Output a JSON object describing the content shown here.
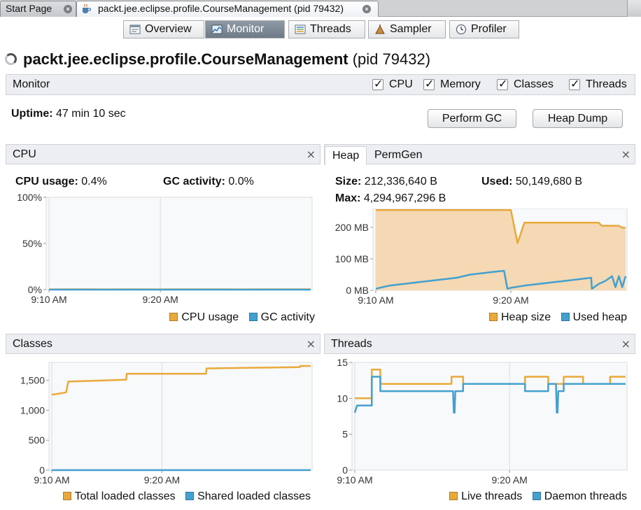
{
  "editor_tabs": [
    {
      "label": "Start Page",
      "active": false
    },
    {
      "label": "packt.jee.eclipse.profile.CourseManagement (pid 79432)",
      "active": true
    }
  ],
  "view_tabs": [
    {
      "label": "Overview",
      "icon": "overview-icon",
      "selected": false
    },
    {
      "label": "Monitor",
      "icon": "monitor-chart-icon",
      "selected": true
    },
    {
      "label": "Threads",
      "icon": "threads-list-icon",
      "selected": false
    },
    {
      "label": "Sampler",
      "icon": "sampler-icon",
      "selected": false
    },
    {
      "label": "Profiler",
      "icon": "profiler-clock-icon",
      "selected": false
    }
  ],
  "header": {
    "title": "packt.jee.eclipse.profile.CourseManagement",
    "pid": "(pid 79432)"
  },
  "monitor_bar": {
    "label": "Monitor",
    "checkboxes": [
      {
        "label": "CPU",
        "checked": true
      },
      {
        "label": "Memory",
        "checked": true
      },
      {
        "label": "Classes",
        "checked": true
      },
      {
        "label": "Threads",
        "checked": true
      }
    ]
  },
  "uptime": {
    "label": "Uptime:",
    "value": "47 min 10 sec"
  },
  "buttons": {
    "perform_gc": "Perform GC",
    "heap_dump": "Heap Dump"
  },
  "colors": {
    "orange": "#e9a93a",
    "blue": "#43a0cf",
    "heap_fill": "#f4d9b4",
    "grid": "#d9dcdf"
  },
  "cpu_panel": {
    "title": "CPU",
    "close": "×",
    "stats": [
      {
        "label": "CPU usage:",
        "value": "0.4%"
      },
      {
        "label": "GC activity:",
        "value": "0.0%"
      }
    ],
    "y_ticks": [
      "100%",
      "50%",
      "0%"
    ],
    "x_ticks": [
      "9:10 AM",
      "9:20 AM"
    ],
    "legend": [
      "CPU usage",
      "GC activity"
    ]
  },
  "heap_panel": {
    "tabs": [
      "Heap",
      "PermGen"
    ],
    "close": "×",
    "size": {
      "label": "Size:",
      "value": "212,336,640 B"
    },
    "used": {
      "label": "Used:",
      "value": "50,149,680 B"
    },
    "max": {
      "label": "Max:",
      "value": "4,294,967,296 B"
    },
    "y_ticks": [
      "200 MB",
      "100 MB",
      "0 MB"
    ],
    "x_ticks": [
      "9:10 AM",
      "9:20 AM"
    ],
    "legend": [
      "Heap size",
      "Used heap"
    ]
  },
  "classes_panel": {
    "title": "Classes",
    "close": "×",
    "y_ticks": [
      "1,500",
      "1,000",
      "500",
      "0"
    ],
    "x_ticks": [
      "9:10 AM",
      "9:20 AM"
    ],
    "legend": [
      "Total loaded classes",
      "Shared loaded classes"
    ]
  },
  "threads_panel": {
    "title": "Threads",
    "close": "×",
    "y_ticks": [
      "15",
      "10",
      "5",
      "0"
    ],
    "x_ticks": [
      "9:10 AM",
      "9:20 AM"
    ],
    "legend": [
      "Live threads",
      "Daemon threads"
    ]
  },
  "chart_data": [
    {
      "type": "line",
      "panel": "CPU",
      "series": [
        {
          "name": "CPU usage",
          "x_min": [
            0,
            5,
            10,
            15,
            20,
            25,
            30,
            35,
            40,
            45,
            47
          ],
          "values": [
            0.3,
            0.4,
            0.3,
            0.4,
            0.3,
            0.4,
            0.4,
            0.3,
            0.4,
            0.4,
            0.4
          ]
        },
        {
          "name": "GC activity",
          "x_min": [
            0,
            47
          ],
          "values": [
            0,
            0
          ]
        }
      ],
      "xlabel": "",
      "ylabel": "",
      "ylim": [
        0,
        100
      ],
      "x_ticks": [
        "9:10 AM",
        "9:20 AM"
      ],
      "legend_position": "bottom-right"
    },
    {
      "type": "area",
      "panel": "Heap",
      "series": [
        {
          "name": "Heap size",
          "unit": "MB",
          "x_min": [
            0,
            0.5,
            20,
            21,
            22,
            33,
            33.5,
            36,
            36.5,
            37
          ],
          "values": [
            255,
            255,
            255,
            150,
            215,
            215,
            205,
            205,
            199,
            199
          ]
        },
        {
          "name": "Used heap",
          "unit": "MB",
          "x_min": [
            0,
            1,
            2,
            4,
            6,
            8,
            10,
            12,
            14,
            16,
            18,
            19,
            19.5,
            20,
            22,
            24,
            26,
            28,
            30,
            31.9,
            32,
            33,
            34,
            35,
            35.5,
            36,
            36.5,
            37
          ],
          "values": [
            5,
            10,
            15,
            20,
            25,
            30,
            35,
            40,
            50,
            55,
            60,
            62,
            5,
            8,
            15,
            20,
            25,
            30,
            35,
            40,
            5,
            20,
            30,
            45,
            10,
            45,
            10,
            45
          ]
        }
      ],
      "xlabel": "",
      "ylabel": "",
      "ylim": [
        0,
        260
      ],
      "y_ticks": [
        0,
        100,
        200
      ],
      "x_ticks": [
        "9:10 AM",
        "9:20 AM"
      ],
      "legend_position": "bottom-right"
    },
    {
      "type": "line",
      "panel": "Classes",
      "series": [
        {
          "name": "Total loaded classes",
          "x_min": [
            0,
            1.4,
            1.5,
            2.6,
            3.0,
            13.5,
            13.6,
            28.0,
            28.1,
            45.0,
            45.1,
            47
          ],
          "values": [
            1260,
            1280,
            1280,
            1300,
            1480,
            1510,
            1610,
            1610,
            1700,
            1720,
            1740,
            1740
          ]
        },
        {
          "name": "Shared loaded classes",
          "x_min": [
            0,
            47
          ],
          "values": [
            0,
            0
          ]
        }
      ],
      "xlabel": "",
      "ylabel": "",
      "ylim": [
        0,
        1800
      ],
      "x_ticks": [
        "9:10 AM",
        "9:20 AM"
      ],
      "legend_position": "bottom-right"
    },
    {
      "type": "line",
      "panel": "Threads",
      "series": [
        {
          "name": "Live threads",
          "x_min": [
            0,
            1.1,
            1.1,
            2.2,
            2.2,
            3.3,
            3.3,
            12.5,
            12.5,
            14.0,
            14.0,
            22.0,
            22.0,
            25.0,
            25.0,
            27.0,
            27.0,
            29.5,
            29.5,
            31.0,
            31.0,
            33.0,
            33.0,
            35.0
          ],
          "values": [
            10,
            10,
            10,
            10,
            14,
            14,
            12,
            12,
            13,
            13,
            12,
            12,
            13,
            13,
            12,
            12,
            13,
            13,
            12,
            12,
            12,
            12,
            13,
            13
          ]
        },
        {
          "name": "Daemon threads",
          "x_min": [
            0,
            0.3,
            0.3,
            1.1,
            1.1,
            2.2,
            2.2,
            3.3,
            3.3,
            12.7,
            12.8,
            12.9,
            13.0,
            14.0,
            14.0,
            22.0,
            22.0,
            25.0,
            25.0,
            26.0,
            26.1,
            26.2,
            26.3,
            27.0,
            27.0,
            35.0
          ],
          "values": [
            8,
            9,
            9,
            9,
            9,
            9,
            13,
            13,
            11,
            11,
            8,
            8,
            11,
            11,
            12,
            12,
            11,
            11,
            12,
            12,
            8,
            8,
            11,
            11,
            12,
            12
          ]
        }
      ],
      "xlabel": "",
      "ylabel": "",
      "ylim": [
        0,
        15
      ],
      "x_ticks": [
        "9:10 AM",
        "9:20 AM"
      ],
      "legend_position": "bottom-right"
    }
  ]
}
